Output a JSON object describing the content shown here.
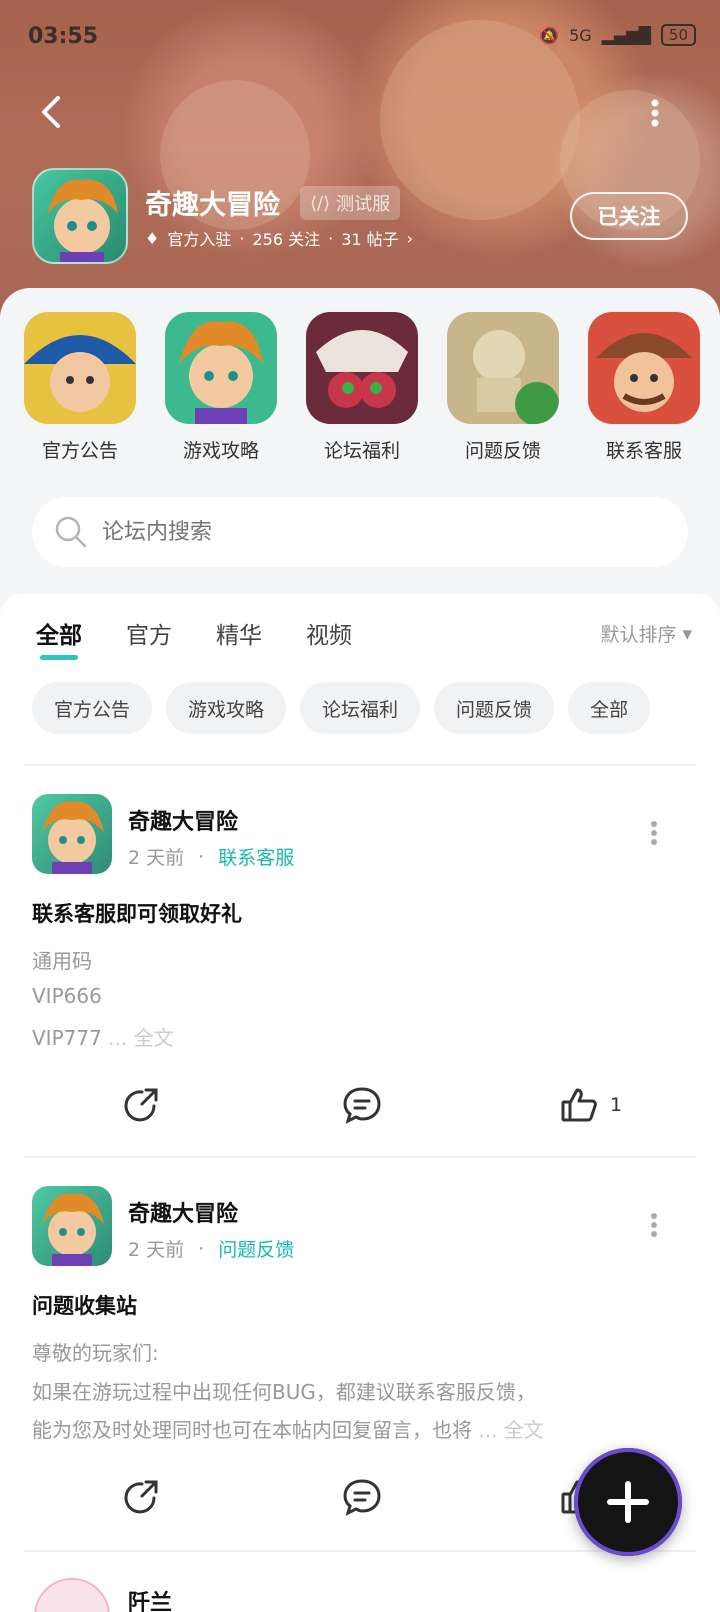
{
  "status_bar": {
    "time": "03:55",
    "network": "5G",
    "battery": "50"
  },
  "header": {
    "game_title": "奇趣大冒险",
    "badge": "测试服",
    "meta_official": "官方入驻",
    "meta_followers": "256 关注",
    "meta_posts": "31 帖子",
    "follow_label": "已关注"
  },
  "shortcuts": [
    {
      "label": "官方公告",
      "icon": "captain-character-icon"
    },
    {
      "label": "游戏攻略",
      "icon": "hero-character-icon"
    },
    {
      "label": "论坛福利",
      "icon": "skull-monster-icon"
    },
    {
      "label": "问题反馈",
      "icon": "statue-character-icon"
    },
    {
      "label": "联系客服",
      "icon": "cowboy-character-icon"
    }
  ],
  "search": {
    "placeholder": "论坛内搜索"
  },
  "tabs": [
    {
      "label": "全部",
      "active": true
    },
    {
      "label": "官方"
    },
    {
      "label": "精华"
    },
    {
      "label": "视频"
    }
  ],
  "sort_label": "默认排序",
  "chips": [
    "官方公告",
    "游戏攻略",
    "论坛福利",
    "问题反馈",
    "全部"
  ],
  "posts": [
    {
      "author": "奇趣大冒险",
      "time": "2 天前",
      "category": "联系客服",
      "title": "联系客服即可领取好礼",
      "lines": [
        "通用码",
        "VIP666",
        "VIP777"
      ],
      "more": " ... 全文",
      "likes": "1"
    },
    {
      "author": "奇趣大冒险",
      "time": "2 天前",
      "category": "问题反馈",
      "title": "问题收集站",
      "lines": [
        "尊敬的玩家们:",
        " 如果在游玩过程中出现任何BUG，都建议联系客服反馈，",
        "能为您及时处理同时也可在本帖内回复留言，也将"
      ],
      "more": " ... 全文",
      "likes": ""
    }
  ],
  "next_post": {
    "author": "阡兰"
  },
  "colors": {
    "accent": "#2ec5c0",
    "category": "#19b9b3",
    "banner": "#a5624d"
  }
}
